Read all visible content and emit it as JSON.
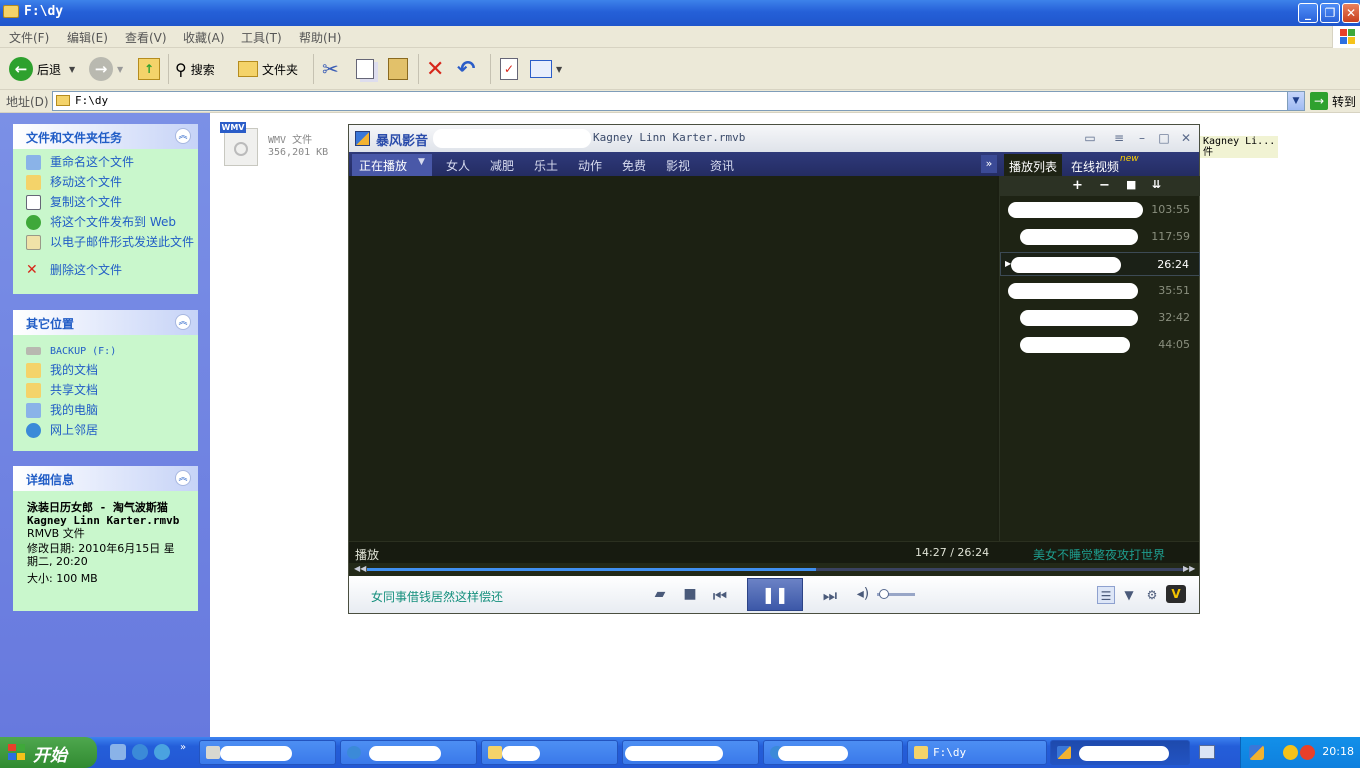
{
  "window": {
    "title": "F:\\dy"
  },
  "menu": [
    "文件(F)",
    "编辑(E)",
    "查看(V)",
    "收藏(A)",
    "工具(T)",
    "帮助(H)"
  ],
  "toolbar": {
    "back": "后退",
    "search": "搜索",
    "folders": "文件夹"
  },
  "address": {
    "label": "地址(D)",
    "value": "F:\\dy",
    "go": "转到"
  },
  "tasks": {
    "file_tasks": {
      "title": "文件和文件夹任务",
      "items": [
        "重命名这个文件",
        "移动这个文件",
        "复制这个文件",
        "将这个文件发布到 Web",
        "以电子邮件形式发送此文件",
        "删除这个文件"
      ]
    },
    "other_places": {
      "title": "其它位置",
      "items": [
        "BACKUP (F:)",
        "我的文档",
        "共享文档",
        "我的电脑",
        "网上邻居"
      ]
    },
    "details": {
      "title": "详细信息",
      "name": "泳装日历女郎 - 淘气波斯猫 Kagney Linn Karter.rmvb",
      "type": "RMVB 文件",
      "modified": "修改日期: 2010年6月15日 星期二, 20:20",
      "size": "大小: 100 MB"
    }
  },
  "file_item": {
    "badge": "WMV",
    "type": "WMV 文件",
    "size": "356,201 KB"
  },
  "background_text": {
    "name_fragment": "Kagney Li...",
    "name_fragment2": "件"
  },
  "player": {
    "app_name": "暴风影音",
    "file_title": "Kagney Linn Karter.rmvb",
    "nav_tabs": [
      "正在播放",
      "女人",
      "减肥",
      "乐土",
      "动作",
      "免费",
      "影视",
      "资讯"
    ],
    "panel_tabs": [
      "播放列表",
      "在线视频"
    ],
    "new_tag": "new",
    "playlist": [
      {
        "duration": "103:55",
        "current": false
      },
      {
        "duration": "117:59",
        "current": false
      },
      {
        "duration": "26:24",
        "current": true
      },
      {
        "duration": "35:51",
        "current": false
      },
      {
        "duration": "32:42",
        "current": false
      },
      {
        "duration": "44:05",
        "current": false
      }
    ],
    "status": "播放",
    "time": "14:27 / 26:24",
    "ad_text": "美女不睡觉整夜攻打世界",
    "bottom_message": "女同事借钱居然这样偿还",
    "progress_fraction": 0.55,
    "volume_fraction": 0.1
  },
  "taskbar": {
    "start": "开始",
    "active_folder": "F:\\dy",
    "clock": "20:18"
  },
  "colors": {
    "xp_blue": "#245ed9",
    "task_pane_bg": "#c9f7cc",
    "task_link": "#215dc6",
    "player_dark": "#1b1f12",
    "player_nav": "#2f3a7a",
    "ad_teal": "#1e9d8e"
  }
}
